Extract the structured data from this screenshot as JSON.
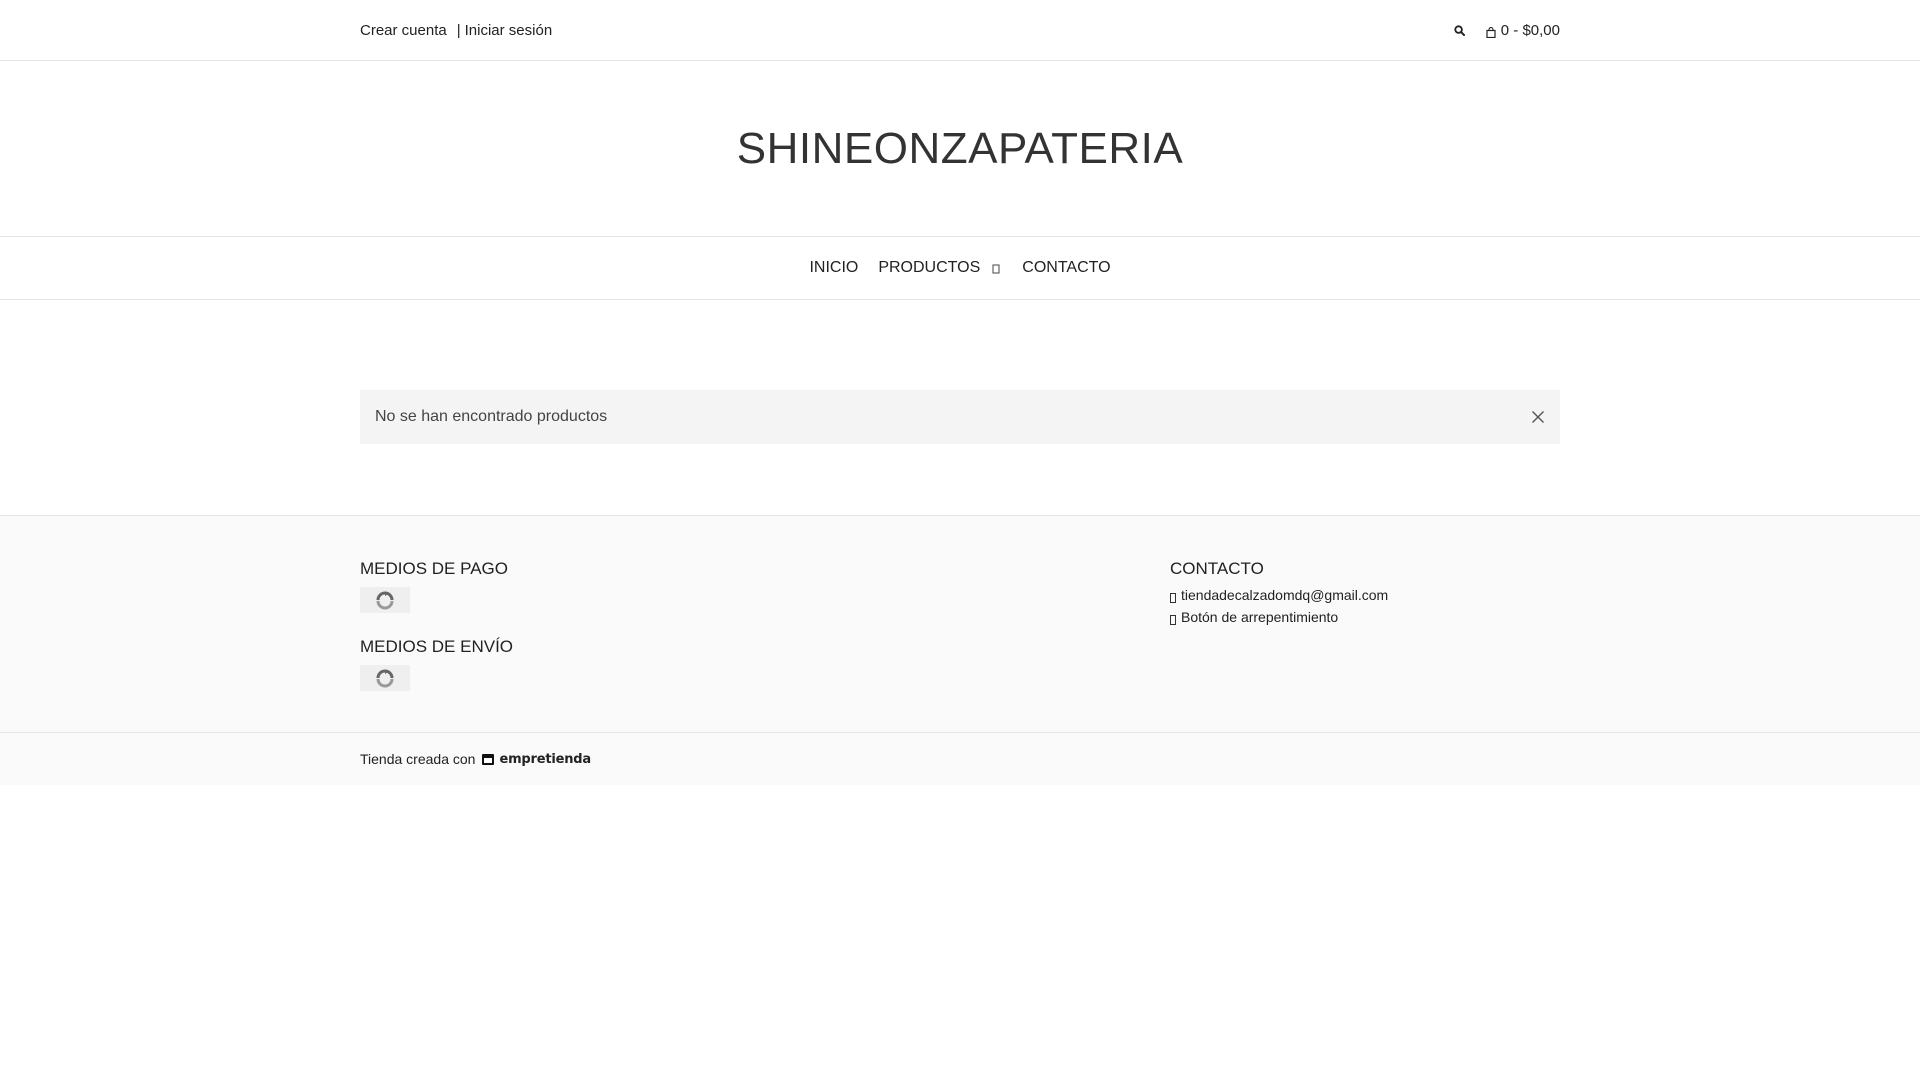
{
  "topbar": {
    "create_account": "Crear cuenta",
    "separator": "|",
    "login": "Iniciar sesión",
    "search_icon": "search-icon",
    "cart_icon": "bag-icon",
    "cart_summary": "0 - $0,00"
  },
  "header": {
    "store_name": "SHINEONZAPATERIA"
  },
  "nav": {
    "items": [
      {
        "label": "INICIO"
      },
      {
        "label": "PRODUCTOS",
        "icon": "chevron-down-icon"
      },
      {
        "label": "CONTACTO"
      }
    ]
  },
  "main": {
    "alert_text": "No se han encontrado productos",
    "close_icon": "close-icon"
  },
  "footer": {
    "payment_heading": "MEDIOS DE PAGO",
    "shipping_heading": "MEDIOS DE ENVÍO",
    "contact_heading": "CONTACTO",
    "email": "tiendadecalzadomdq@gmail.com",
    "regret_button": "Botón de arrepentimiento",
    "created_with": "Tienda creada con",
    "brand": "empretienda"
  },
  "colors": {
    "text": "#222222",
    "title": "#333333",
    "alert_bg": "#f4f4f4",
    "footer_bg": "#fafafa",
    "border": "#e3e3e3"
  }
}
